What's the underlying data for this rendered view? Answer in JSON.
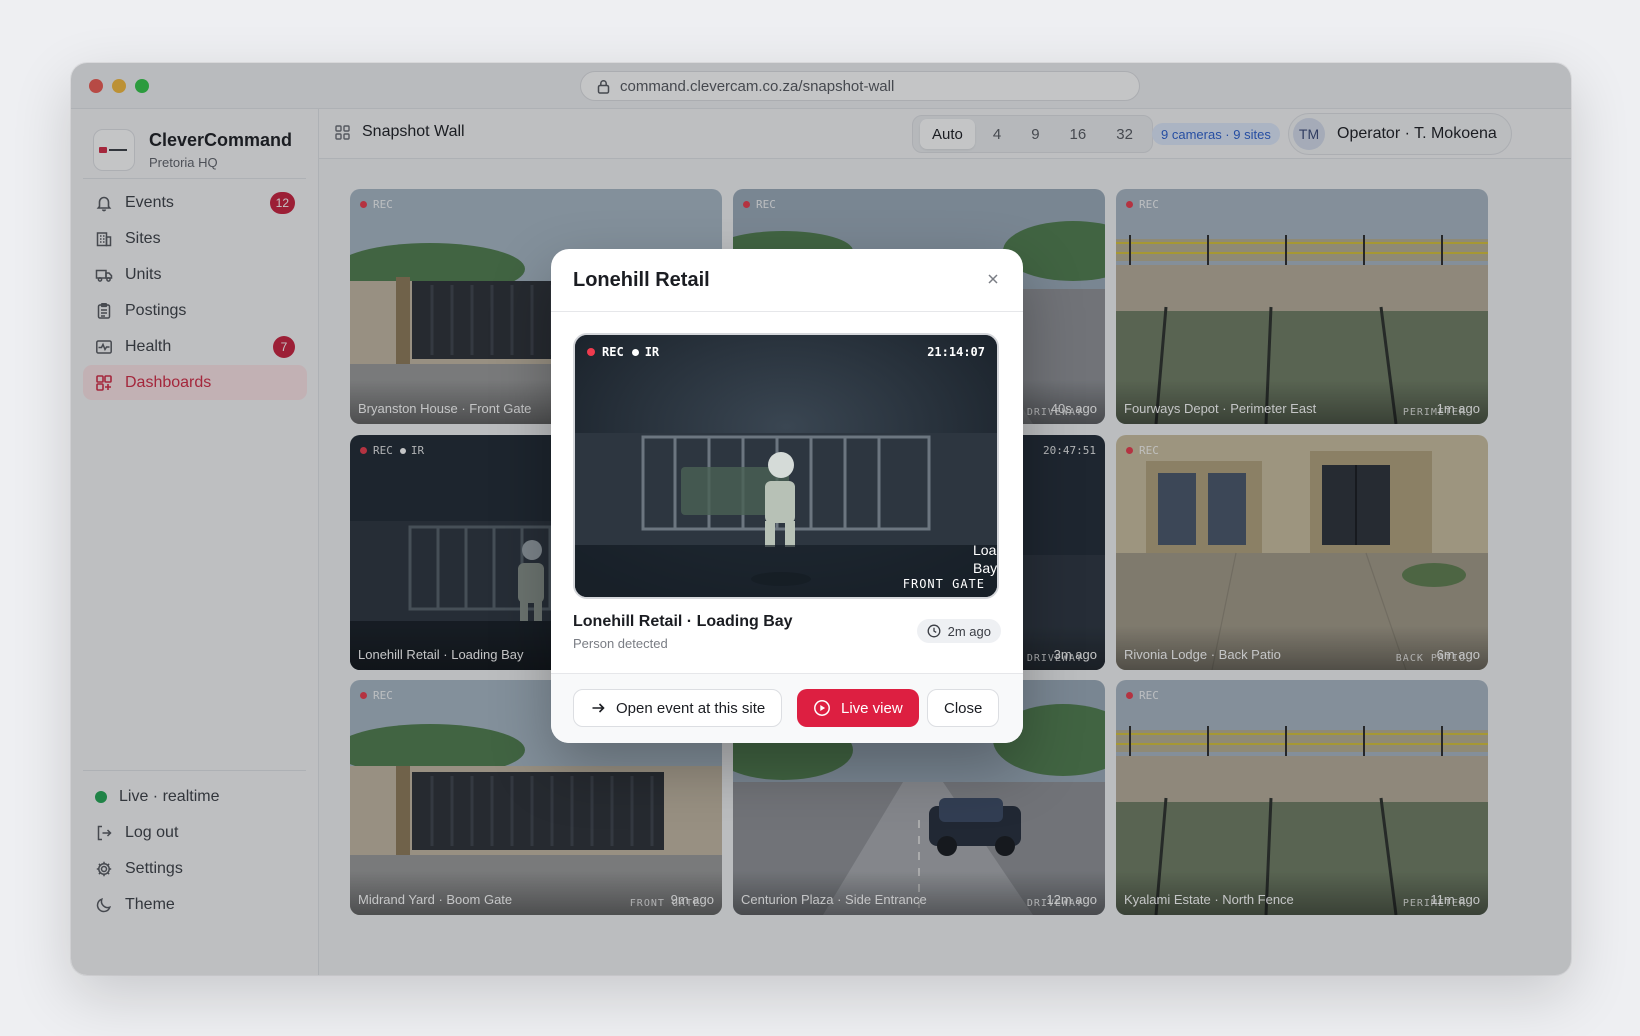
{
  "browser": {
    "url": "command.clevercam.co.za/snapshot-wall"
  },
  "brand": {
    "name": "CleverCommand",
    "subtitle": "Pretoria HQ"
  },
  "nav": [
    {
      "label": "Events",
      "badge": "12"
    },
    {
      "label": "Sites"
    },
    {
      "label": "Units"
    },
    {
      "label": "Postings"
    },
    {
      "label": "Health",
      "badge": "7"
    },
    {
      "label": "Dashboards",
      "active": true
    }
  ],
  "sidebar_bottom": {
    "status": "Live · realtime",
    "logout": "Log out",
    "settings": "Settings",
    "theme": "Theme"
  },
  "header": {
    "title": "Snapshot Wall",
    "layout_options": [
      "Auto",
      "4",
      "9",
      "16",
      "32"
    ],
    "layout_selected": "Auto",
    "count_badge": "9 cameras · 9 sites",
    "operator_initials": "TM",
    "operator_label": "Operator · T. Mokoena"
  },
  "tiles": [
    {
      "caption": "Bryanston House · Front Gate",
      "rec": "REC",
      "tag": "",
      "age": ""
    },
    {
      "caption": "",
      "rec": "REC",
      "tag": "DRIVEWAY",
      "age": "40s ago"
    },
    {
      "caption": "Fourways Depot · Perimeter East",
      "rec": "REC",
      "tag": "PERIMETER",
      "age": "1m ago"
    },
    {
      "caption": "Lonehill Retail · Loading Bay",
      "rec": "REC",
      "ir": "IR",
      "tag": "",
      "age": ""
    },
    {
      "caption": "",
      "time": "20:47:51",
      "tag": "DRIVEWAY",
      "age": "3m ago"
    },
    {
      "caption": "Rivonia Lodge · Back Patio",
      "rec": "REC",
      "tag": "BACK PATIO",
      "age": "6m ago"
    },
    {
      "caption": "Midrand Yard · Boom Gate",
      "rec": "REC",
      "tag": "FRONT GATE",
      "age": "9m ago"
    },
    {
      "caption": "Centurion Plaza · Side Entrance",
      "rec": "",
      "tag": "DRIVEWAY",
      "age": "12m ago"
    },
    {
      "caption": "Kyalami Estate · North Fence",
      "rec": "REC",
      "tag": "PERIMETER",
      "age": "11m ago"
    }
  ],
  "modal": {
    "title": "Lonehill Retail",
    "video": {
      "rec": "REC",
      "ir": "IR",
      "time": "21:14:07",
      "tag": "FRONT GATE",
      "camera": "Loading Bay"
    },
    "event_name": "Lonehill Retail · Loading Bay",
    "event_type": "Person detected",
    "age": "2m ago",
    "buttons": {
      "open_event": "Open event at this site",
      "live_view": "Live view",
      "close": "Close"
    }
  },
  "colors": {
    "accent": "#dd1f41",
    "badge": "#c9203d",
    "live": "#22a654",
    "info": "#2b5fcf"
  }
}
